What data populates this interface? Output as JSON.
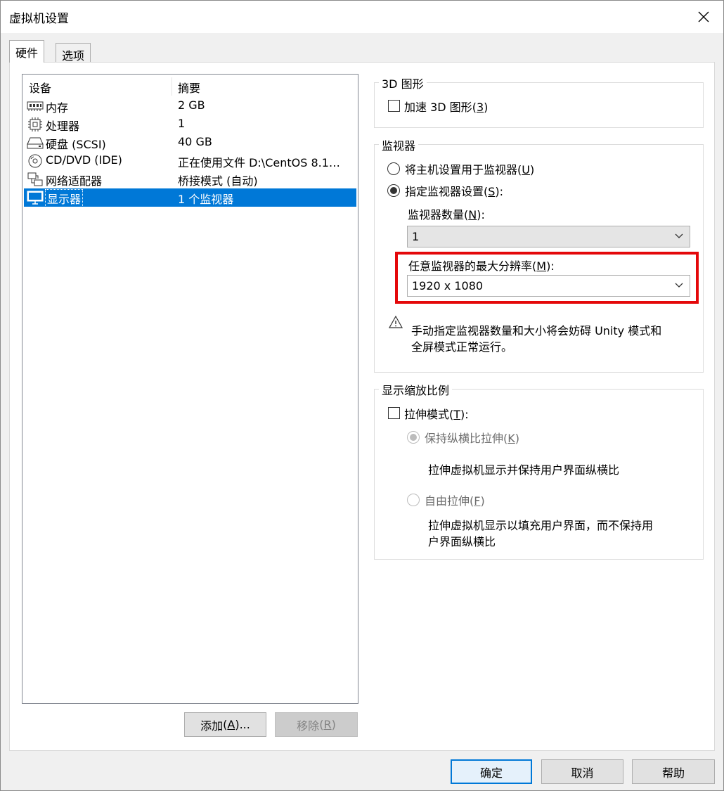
{
  "window": {
    "title": "虚拟机设置"
  },
  "tabs": [
    {
      "label": "硬件",
      "selected": true
    },
    {
      "label": "选项",
      "selected": false
    }
  ],
  "device_list": {
    "headers": {
      "device": "设备",
      "summary": "摘要"
    },
    "items": [
      {
        "icon": "memory-icon",
        "name": "内存",
        "summary": "2 GB",
        "selected": false
      },
      {
        "icon": "cpu-icon",
        "name": "处理器",
        "summary": "1",
        "selected": false
      },
      {
        "icon": "hard-disk-icon",
        "name": "硬盘 (SCSI)",
        "summary": "40 GB",
        "selected": false
      },
      {
        "icon": "cd-dvd-icon",
        "name": "CD/DVD (IDE)",
        "summary": "正在使用文件 D:\\CentOS 8.1…",
        "selected": false
      },
      {
        "icon": "network-adapter-icon",
        "name": "网络适配器",
        "summary": "桥接模式 (自动)",
        "selected": false
      },
      {
        "icon": "monitor-icon",
        "name": "显示器",
        "summary": "1 个监视器",
        "selected": true
      }
    ],
    "add_button": {
      "label": "添加",
      "key": "A",
      "suffix": "..."
    },
    "remove_button": {
      "label": "移除",
      "key": "R",
      "disabled": true
    }
  },
  "graphics_3d": {
    "group_label": "3D 图形",
    "accelerate": {
      "label": "加速 3D 图形",
      "key": "3",
      "checked": false
    }
  },
  "monitor": {
    "group_label": "监视器",
    "use_host": {
      "label": "将主机设置用于监视器",
      "key": "U",
      "checked": false
    },
    "specify": {
      "label": "指定监视器设置",
      "key": "S",
      "suffix": ":",
      "checked": true
    },
    "count_label": {
      "label": "监视器数量",
      "key": "N",
      "suffix": ":"
    },
    "count_value": "1",
    "max_res_label": {
      "label": "任意监视器的最大分辨率",
      "key": "M",
      "suffix": ":"
    },
    "max_res_value": "1920 x 1080",
    "warning_icon": "warning-triangle-icon",
    "warning_line1": "手动指定监视器数量和大小将会妨碍 Unity 模式和",
    "warning_line2": "全屏模式正常运行。",
    "highlight_color": "#e4080a"
  },
  "display_scaling": {
    "group_label": "显示缩放比例",
    "stretch": {
      "label": "拉伸模式",
      "key": "T",
      "suffix": ":",
      "checked": false
    },
    "keep_aspect": {
      "label": "保持纵横比拉伸",
      "key": "K",
      "checked": true,
      "disabled": true
    },
    "keep_aspect_desc": "拉伸虚拟机显示并保持用户界面纵横比",
    "free_stretch": {
      "label": "自由拉伸",
      "key": "F",
      "checked": false,
      "disabled": true
    },
    "free_desc_line1": "拉伸虚拟机显示以填充用户界面，而不保持用",
    "free_desc_line2": "户界面纵横比"
  },
  "footer": {
    "ok": "确定",
    "cancel": "取消",
    "help": "帮助"
  },
  "colors": {
    "selection": "#0078d7",
    "accent": "#0078d7"
  }
}
